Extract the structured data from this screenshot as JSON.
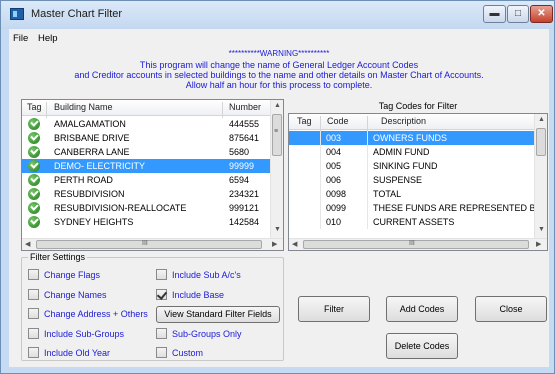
{
  "window": {
    "title": "Master Chart Filter",
    "minimize_glyph": "▬",
    "maximize_glyph": "□",
    "close_glyph": "✕"
  },
  "menu": {
    "file": "File",
    "help": "Help"
  },
  "warning": {
    "line1": "**********WARNING**********",
    "line2": "This program will change the name of General Ledger Account Codes",
    "line3": "and Creditor accounts in  selected buildings to the name and other details on Master Chart of Accounts.",
    "line4": "Allow half an hour for this process to complete."
  },
  "buildings": {
    "columns": {
      "tag": "Tag",
      "name": "Building Name",
      "number": "Number"
    },
    "rows": [
      {
        "name": "AMALGAMATION",
        "number": "444555",
        "tagged": true,
        "selected": false
      },
      {
        "name": "BRISBANE DRIVE",
        "number": "875641",
        "tagged": true,
        "selected": false
      },
      {
        "name": "CANBERRA LANE",
        "number": "5680",
        "tagged": true,
        "selected": false
      },
      {
        "name": "DEMO- ELECTRICITY",
        "number": "99999",
        "tagged": true,
        "selected": true
      },
      {
        "name": "PERTH ROAD",
        "number": "6594",
        "tagged": true,
        "selected": false
      },
      {
        "name": "RESUBDIVISION",
        "number": "234321",
        "tagged": true,
        "selected": false
      },
      {
        "name": "RESUBDIVISION-REALLOCATE",
        "number": "999121",
        "tagged": true,
        "selected": false
      },
      {
        "name": "SYDNEY HEIGHTS",
        "number": "142584",
        "tagged": true,
        "selected": false
      }
    ]
  },
  "tag_codes": {
    "label": "Tag Codes for Filter",
    "columns": {
      "tag": "Tag",
      "code": "Code",
      "description": "Description"
    },
    "rows": [
      {
        "code": "003",
        "description": "OWNERS FUNDS",
        "selected": true
      },
      {
        "code": "004",
        "description": "ADMIN FUND",
        "selected": false
      },
      {
        "code": "005",
        "description": "SINKING FUND",
        "selected": false
      },
      {
        "code": "006",
        "description": "SUSPENSE",
        "selected": false
      },
      {
        "code": "0098",
        "description": "TOTAL",
        "selected": false
      },
      {
        "code": "0099",
        "description": "THESE FUNDS ARE REPRESENTED BY",
        "selected": false
      },
      {
        "code": "010",
        "description": "CURRENT ASSETS",
        "selected": false
      }
    ]
  },
  "filter_settings": {
    "legend": "Filter Settings",
    "change_flags": {
      "label": "Change Flags",
      "checked": false
    },
    "include_sub_ac": {
      "label": "Include Sub A/c's",
      "checked": false
    },
    "change_names": {
      "label": "Change Names",
      "checked": false
    },
    "include_base": {
      "label": "Include Base",
      "checked": true
    },
    "change_address": {
      "label": "Change Address + Others",
      "checked": false
    },
    "include_sub_groups": {
      "label": "Include Sub-Groups",
      "checked": false
    },
    "sub_groups_only": {
      "label": "Sub-Groups Only",
      "checked": false
    },
    "include_old_year": {
      "label": "Include Old Year",
      "checked": false
    },
    "custom": {
      "label": "Custom",
      "checked": false
    },
    "view_standard_button": "View Standard Filter Fields"
  },
  "buttons": {
    "filter": "Filter",
    "add_codes": "Add Codes",
    "close": "Close",
    "delete_codes": "Delete Codes"
  },
  "scroll_glyphs": {
    "up": "▲",
    "down": "▼",
    "left": "◀",
    "right": "▶",
    "grip": "≡",
    "hgrip": "III"
  },
  "colors": {
    "selection": "#3399ff",
    "warning_text": "#1a1ad8",
    "tag_check": "#1f7a1c"
  }
}
